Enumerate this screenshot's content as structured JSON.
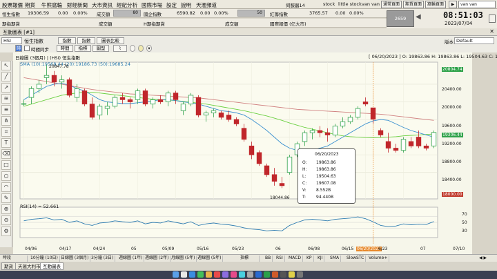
{
  "menu": [
    "股票報價",
    "期貨",
    "牛熊窩輪",
    "財經新聞",
    "大市資訊",
    "經紀分析",
    "國際市場",
    "設定",
    "說明",
    "天滙頻道"
  ],
  "menu_right": {
    "status": "伺服器14",
    "t1": "stock",
    "t2": "little stock",
    "user": "van van",
    "b1": "通常頁面",
    "b2": "期貨頁面",
    "b3": "窩輪頁面"
  },
  "quote1": {
    "name": "恒生指數",
    "value": "19306.59",
    "chg": "0.00",
    "pct": "0.00%",
    "label": "成交額",
    "mid_name": "國企指數",
    "mid_value": "6590.82",
    "mid_chg": "0.00",
    "mid_pct": "0.00%",
    "box1": "80",
    "box2": "50",
    "r_name": "紅籌指數",
    "r_value": "3765.57",
    "r_chg": "0.00",
    "r_pct": "0.00%"
  },
  "quote2": {
    "name": "期指期貨",
    "label": "成交額",
    "mid_name": "H期指期貨",
    "mid_label": "成交額",
    "r_name": "國際報價 (亿大市)"
  },
  "clock": {
    "time": "08:51:03",
    "date": "2023/07/04",
    "toggle": "2659",
    "user": "van van"
  },
  "window_title": "互動圖表 [#1]",
  "toolbar": {
    "symbol": "HSI",
    "name": "恒生指數",
    "b_index": "指數",
    "b_list": "指數",
    "b_compare": "圖表比較",
    "b_period": "時段",
    "chk_label": "時間同步",
    "b_time": "時間",
    "b_ind": "指標",
    "b_chart": "圖型",
    "version": "版本",
    "version_val": "Default"
  },
  "chart_header": {
    "left": "日線圖 (3個月) | (HSI) 恒生指數",
    "right": "[ 06/20/2023 ] O: 19863.86 H: 19863.86 L: 19504.63 C: 19607.0",
    "sma": "SMA (10):19568.44 (20):19186.73 (50):19685.24",
    "rsi": "RSI(14) = 52.661"
  },
  "tooltip": {
    "date": "06/20/2023",
    "o_label": "O:",
    "o": "19863.86",
    "h_label": "H:",
    "h": "19863.86",
    "l_label": "L:",
    "l": "19504.63",
    "c_label": "C:",
    "c": "19607.08",
    "v_label": "V:",
    "v": "8.552B",
    "t_label": "T:",
    "t": "94.440B"
  },
  "annotations": {
    "high": "20847.78",
    "low": "18044.86",
    "cursor_date": "06/20/2023"
  },
  "y_labels": {
    "top": "20804.74",
    "p1": "20400.00",
    "p2": "20000.00",
    "p3": "19600.00",
    "p4": "19306.44",
    "p5": "19200.00",
    "p6": "18800.00",
    "p7": "18400.00",
    "bottom": "18000.00"
  },
  "rsi_labels": [
    "70",
    "50",
    "30"
  ],
  "x_labels": [
    "04/06",
    "04/17",
    "04/24",
    "05",
    "05/09",
    "05/16",
    "05/23",
    "06",
    "06/08",
    "06/15",
    "06/20/2023",
    "6/23",
    "07",
    "07/10"
  ],
  "bottombar": [
    "時段",
    "10分鐘 (10日)",
    "日線圖 (3個月)",
    "3分鐘 (3日)",
    "週線圖 (1年)",
    "週線圖 (2年)",
    "月線圖 (5年)",
    "週線圖 (5年)",
    "指標",
    "BB",
    "RSI",
    "MACD",
    "KP",
    "KJI",
    "SMA",
    "SlowSTC",
    "Volume+"
  ],
  "tabs": [
    "期貨",
    "天滙大利市",
    "互動圖表"
  ],
  "chart_data": {
    "type": "candlestick",
    "ylim": [
      17800,
      20900
    ],
    "candles": [
      {
        "o": 19950,
        "h": 20050,
        "l": 19900,
        "c": 19960
      },
      {
        "o": 20100,
        "h": 20350,
        "l": 19950,
        "c": 20300
      },
      {
        "o": 20300,
        "h": 20500,
        "l": 20200,
        "c": 20400
      },
      {
        "o": 20550,
        "h": 20848,
        "l": 20400,
        "c": 20600
      },
      {
        "o": 20600,
        "h": 20700,
        "l": 20350,
        "c": 20450
      },
      {
        "o": 20450,
        "h": 20600,
        "l": 20300,
        "c": 20500
      },
      {
        "o": 20500,
        "h": 20550,
        "l": 20100,
        "c": 20150
      },
      {
        "o": 20100,
        "h": 20400,
        "l": 20000,
        "c": 20300
      },
      {
        "o": 20250,
        "h": 20300,
        "l": 19900,
        "c": 19950
      },
      {
        "o": 19950,
        "h": 20100,
        "l": 19600,
        "c": 19650
      },
      {
        "o": 19700,
        "h": 19950,
        "l": 19600,
        "c": 19900
      },
      {
        "o": 19850,
        "h": 20000,
        "l": 19700,
        "c": 19900
      },
      {
        "o": 19900,
        "h": 20150,
        "l": 19850,
        "c": 20100
      },
      {
        "o": 20100,
        "h": 20200,
        "l": 19950,
        "c": 20050
      },
      {
        "o": 20050,
        "h": 20100,
        "l": 19850,
        "c": 20000
      },
      {
        "o": 20050,
        "h": 20300,
        "l": 19950,
        "c": 20250
      },
      {
        "o": 20250,
        "h": 20300,
        "l": 19900,
        "c": 19950
      },
      {
        "o": 19950,
        "h": 20100,
        "l": 19850,
        "c": 20050
      },
      {
        "o": 20050,
        "h": 20150,
        "l": 19950,
        "c": 20000
      },
      {
        "o": 20000,
        "h": 20250,
        "l": 19900,
        "c": 20200
      },
      {
        "o": 20200,
        "h": 20250,
        "l": 19950,
        "c": 20050
      },
      {
        "o": 19800,
        "h": 20000,
        "l": 19700,
        "c": 19950
      },
      {
        "o": 19950,
        "h": 20200,
        "l": 19900,
        "c": 20150
      },
      {
        "o": 20100,
        "h": 20150,
        "l": 19650,
        "c": 19700
      },
      {
        "o": 19700,
        "h": 19800,
        "l": 19550,
        "c": 19750
      },
      {
        "o": 19750,
        "h": 19850,
        "l": 19650,
        "c": 19800
      },
      {
        "o": 19750,
        "h": 19800,
        "l": 19600,
        "c": 19650
      },
      {
        "o": 19700,
        "h": 19800,
        "l": 19550,
        "c": 19600
      },
      {
        "o": 19600,
        "h": 19650,
        "l": 19450,
        "c": 19500
      },
      {
        "o": 19400,
        "h": 19500,
        "l": 19100,
        "c": 19150
      },
      {
        "o": 19000,
        "h": 19100,
        "l": 18700,
        "c": 18800
      },
      {
        "o": 18850,
        "h": 18900,
        "l": 18550,
        "c": 18600
      },
      {
        "o": 18550,
        "h": 18600,
        "l": 18300,
        "c": 18350
      },
      {
        "o": 18350,
        "h": 18500,
        "l": 18100,
        "c": 18200
      },
      {
        "o": 18150,
        "h": 18300,
        "l": 18045,
        "c": 18100
      },
      {
        "o": 18400,
        "h": 18800,
        "l": 18350,
        "c": 18750
      },
      {
        "o": 18800,
        "h": 19100,
        "l": 18750,
        "c": 19050
      },
      {
        "o": 19100,
        "h": 19350,
        "l": 19000,
        "c": 19300
      },
      {
        "o": 19300,
        "h": 19400,
        "l": 19150,
        "c": 19350
      },
      {
        "o": 19350,
        "h": 19450,
        "l": 19200,
        "c": 19300
      },
      {
        "o": 19300,
        "h": 19400,
        "l": 19100,
        "c": 19250
      },
      {
        "o": 19250,
        "h": 19500,
        "l": 19200,
        "c": 19450
      },
      {
        "o": 19450,
        "h": 19650,
        "l": 19400,
        "c": 19550
      },
      {
        "o": 19550,
        "h": 19700,
        "l": 19500,
        "c": 19650
      },
      {
        "o": 19650,
        "h": 19900,
        "l": 19600,
        "c": 19850
      },
      {
        "o": 20000,
        "h": 20100,
        "l": 19900,
        "c": 19950
      },
      {
        "o": 19864,
        "h": 19864,
        "l": 19505,
        "c": 19607
      },
      {
        "o": 19350,
        "h": 19400,
        "l": 19200,
        "c": 19250
      },
      {
        "o": 19100,
        "h": 19300,
        "l": 18850,
        "c": 18950
      },
      {
        "o": 18950,
        "h": 19050,
        "l": 18850,
        "c": 18900
      },
      {
        "o": 18900,
        "h": 19200,
        "l": 18850,
        "c": 19150
      },
      {
        "o": 19100,
        "h": 19200,
        "l": 18950,
        "c": 19000
      },
      {
        "o": 19200,
        "h": 19350,
        "l": 18950,
        "c": 19000
      },
      {
        "o": 19000,
        "h": 19050,
        "l": 18900,
        "c": 18950
      },
      {
        "o": 19000,
        "h": 19350,
        "l": 18950,
        "c": 19306
      }
    ],
    "sma10": [
      20050,
      20150,
      20250,
      20350,
      20400,
      20420,
      20380,
      20300,
      20250,
      20150,
      20050,
      20000,
      19980,
      19960,
      19960,
      19980,
      20000,
      20020,
      20050,
      20050,
      20030,
      20000,
      19980,
      19950,
      19900,
      19850,
      19800,
      19780,
      19750,
      19700,
      19600,
      19480,
      19350,
      19200,
      19050,
      18950,
      18900,
      18880,
      18900,
      18950,
      19000,
      19100,
      19200,
      19300,
      19400,
      19500,
      19568,
      19600,
      19580,
      19500,
      19420,
      19350,
      19300,
      19250,
      19200
    ],
    "sma20": [
      19900,
      19950,
      20000,
      20050,
      20100,
      20150,
      20180,
      20200,
      20220,
      20220,
      20200,
      20180,
      20160,
      20140,
      20120,
      20100,
      20080,
      20060,
      20050,
      20040,
      20030,
      20010,
      19990,
      19970,
      19950,
      19920,
      19890,
      19860,
      19830,
      19800,
      19760,
      19720,
      19680,
      19630,
      19580,
      19520,
      19470,
      19420,
      19380,
      19340,
      19300,
      19260,
      19230,
      19210,
      19200,
      19190,
      19187,
      19190,
      19200,
      19210,
      19230,
      19240,
      19250,
      19260,
      19270
    ],
    "sma50": [
      20550,
      20520,
      20490,
      20460,
      20430,
      20400,
      20370,
      20340,
      20310,
      20280,
      20260,
      20240,
      20220,
      20200,
      20180,
      20170,
      20160,
      20150,
      20140,
      20130,
      20120,
      20110,
      20100,
      20090,
      20070,
      20050,
      20030,
      20010,
      19990,
      19970,
      19950,
      19930,
      19910,
      19890,
      19870,
      19850,
      19830,
      19820,
      19810,
      19800,
      19790,
      19780,
      19770,
      19760,
      19750,
      19740,
      19730,
      19720,
      19700,
      19680,
      19660,
      19640,
      19620,
      19600,
      19580
    ],
    "rsi": [
      55,
      60,
      62,
      65,
      58,
      60,
      50,
      55,
      45,
      40,
      48,
      50,
      55,
      52,
      50,
      55,
      45,
      50,
      48,
      55,
      50,
      45,
      52,
      40,
      45,
      48,
      44,
      42,
      38,
      32,
      28,
      26,
      22,
      24,
      22,
      40,
      50,
      58,
      60,
      58,
      55,
      60,
      62,
      64,
      68,
      62,
      52,
      40,
      36,
      38,
      45,
      42,
      44,
      43,
      52.661
    ],
    "rsi_ylim": [
      0,
      100
    ]
  }
}
